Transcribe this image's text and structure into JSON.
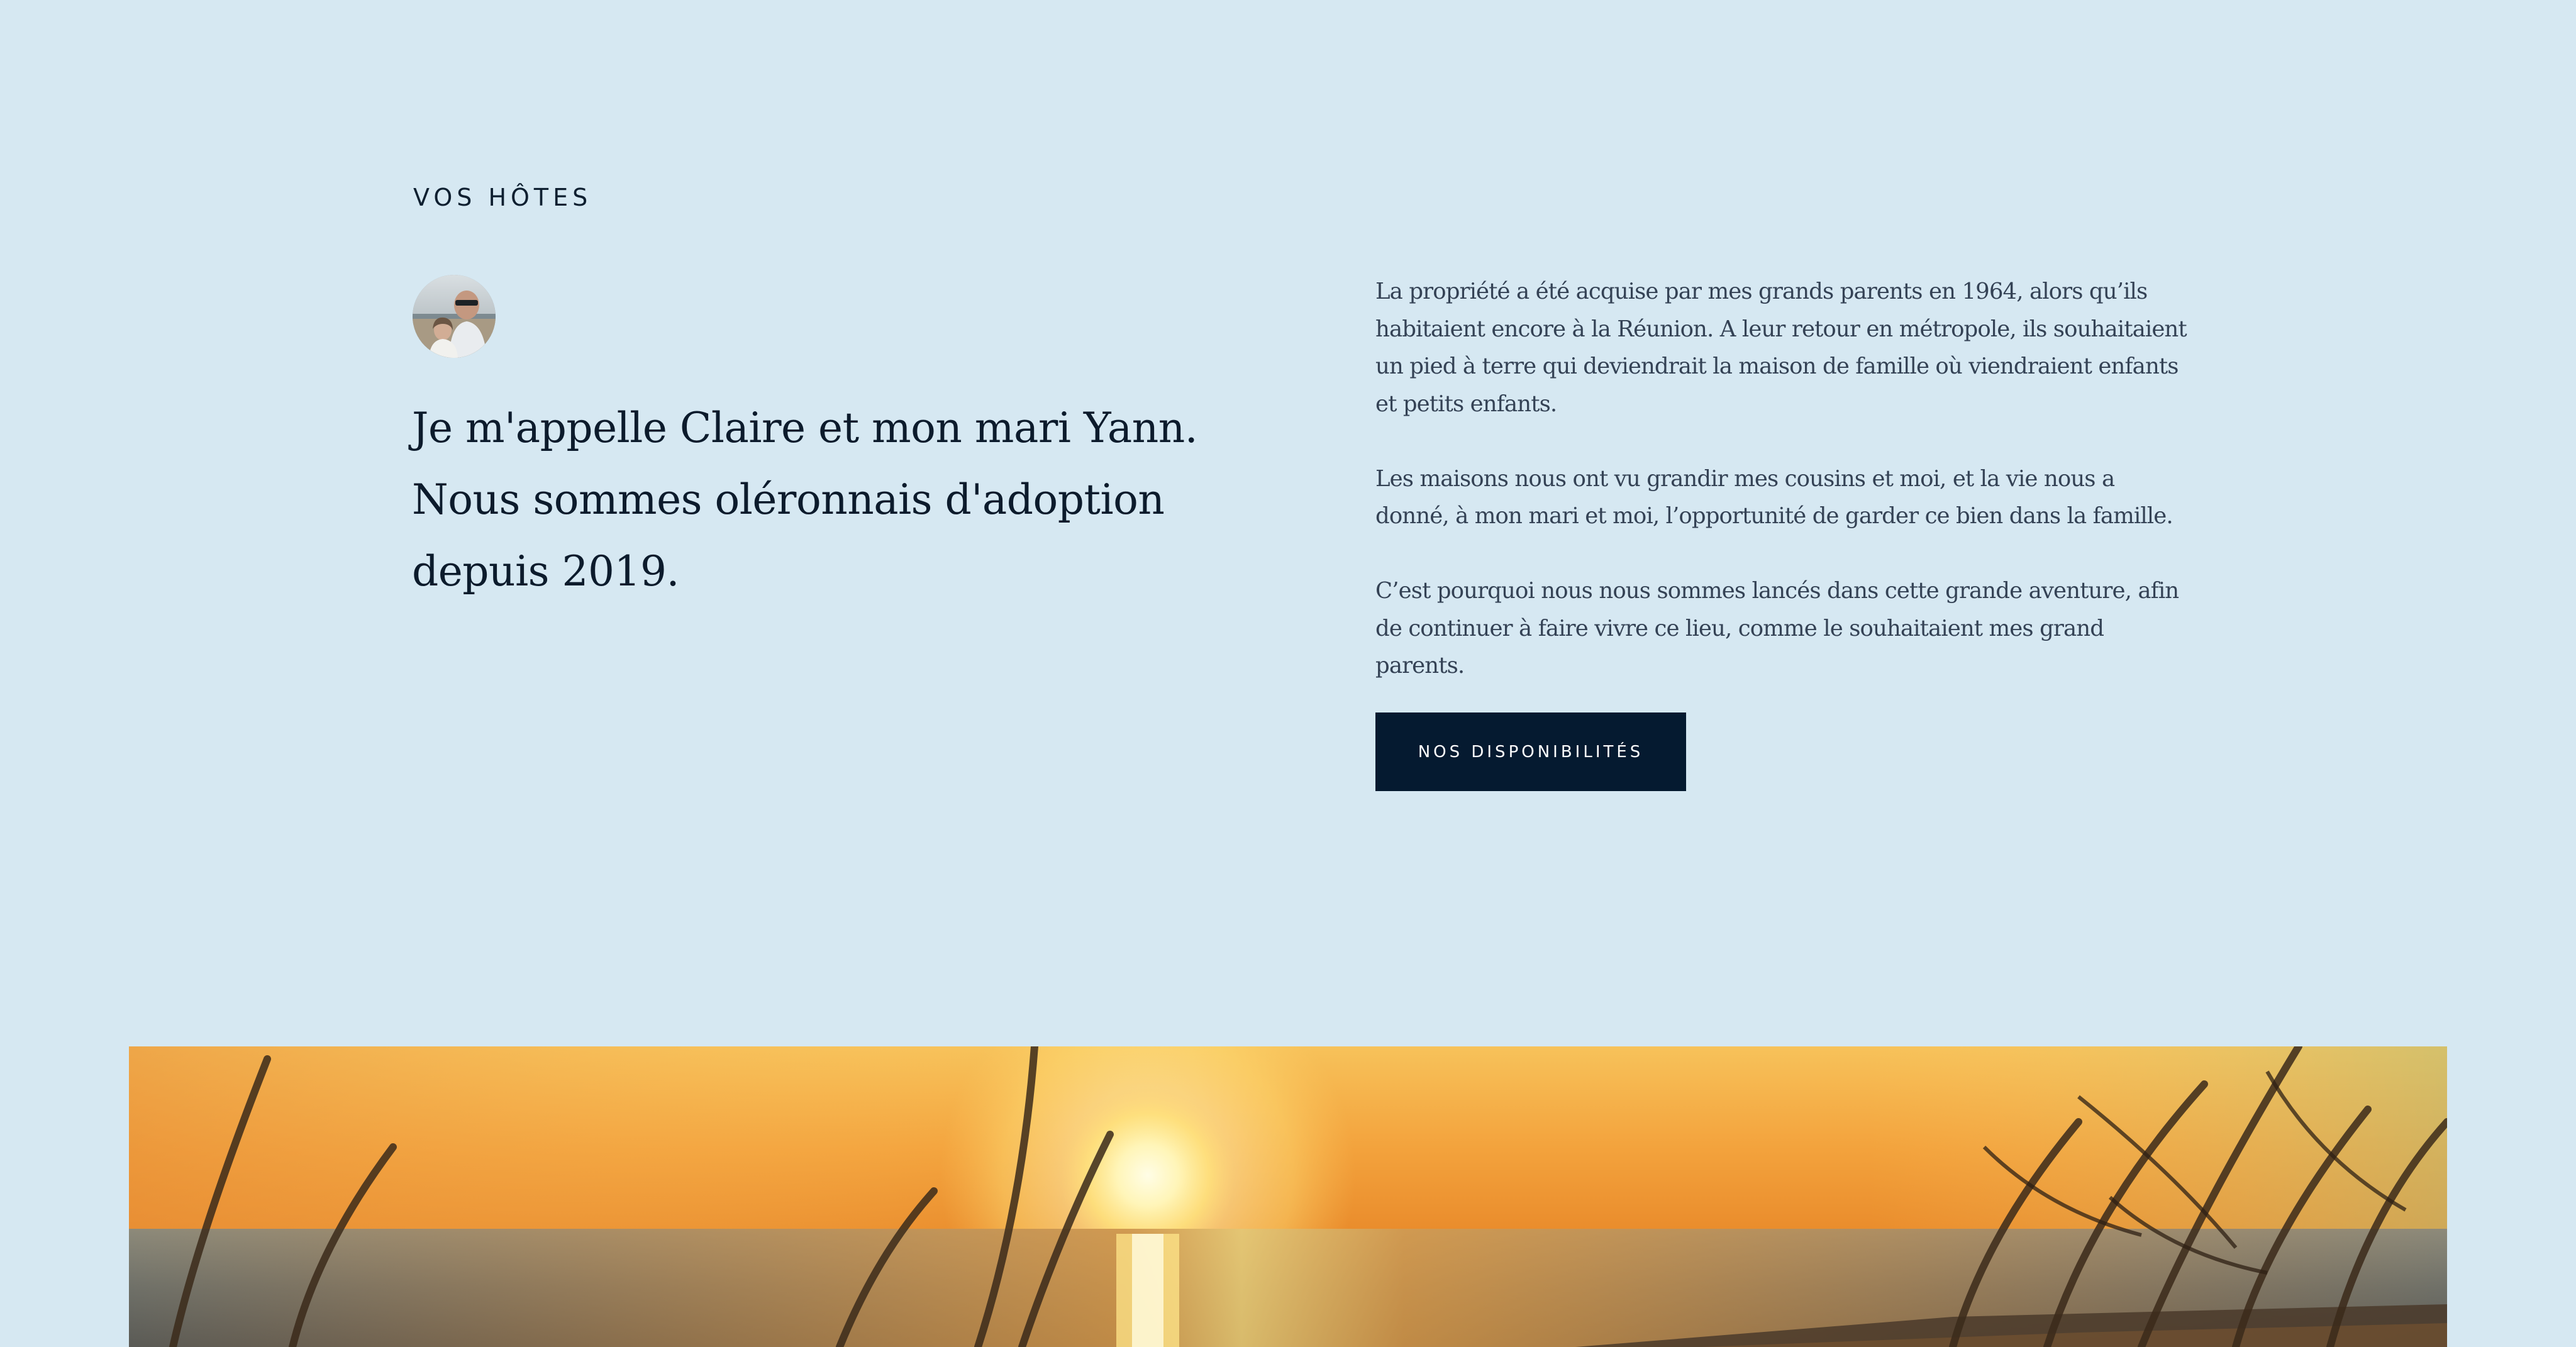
{
  "hosts_section": {
    "eyebrow": "VOS HÔTES",
    "avatar_alt": "Claire et Yann",
    "headline": "Je m'appelle Claire et mon mari Yann. Nous sommes oléronnais d'adoption depuis 2019.",
    "paragraphs": [
      "La propriété a été acquise par mes grands parents en 1964, alors qu’ils habitaient encore à la Réunion. A leur retour en métropole, ils souhaitaient un pied à terre qui deviendrait la maison de famille où viendraient enfants et petits enfants.",
      "Les maisons nous ont vu grandir mes cousins et moi, et la vie nous a donné, à mon mari et moi, l’opportunité de garder ce bien dans la famille.",
      "C’est pourquoi nous nous sommes lancés dans cette grande aventure, afin de continuer à faire vivre ce lieu, comme le souhaitaient mes grand parents."
    ],
    "cta_label": "NOS DISPONIBILITÉS"
  },
  "hero_image": {
    "alt": "Coucher de soleil sur la plage"
  },
  "colors": {
    "background": "#d6e8f2",
    "text_dark": "#0c1b2c",
    "button_bg": "#051a30",
    "button_text": "#ffffff"
  }
}
